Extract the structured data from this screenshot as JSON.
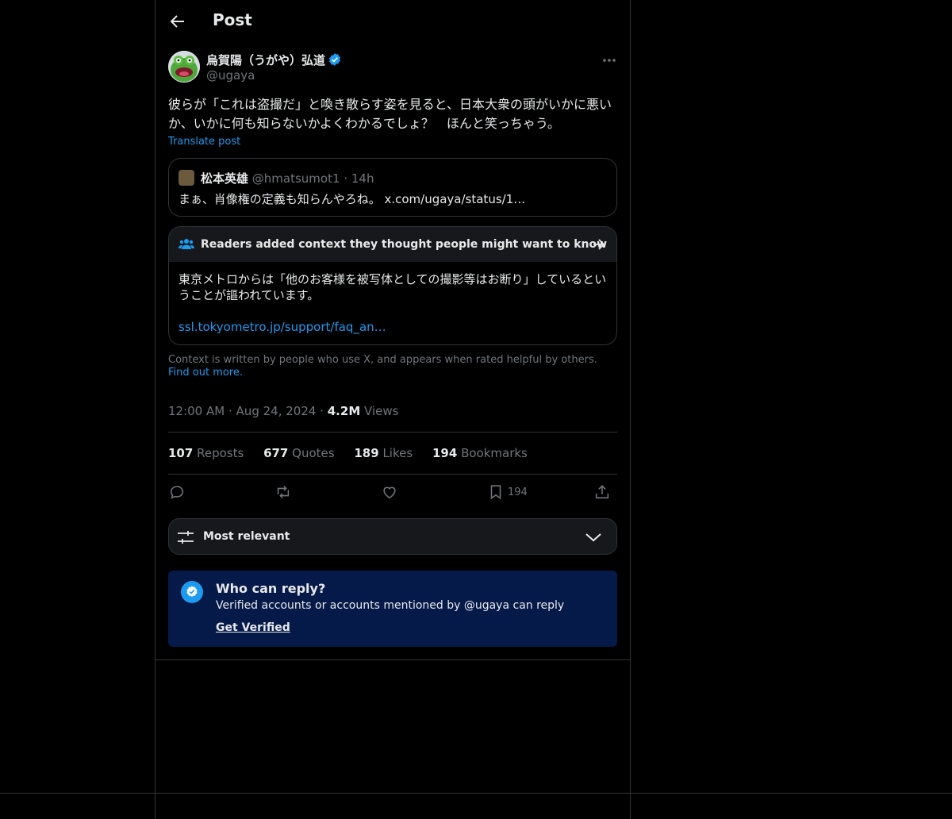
{
  "header": {
    "title": "Post"
  },
  "author": {
    "name": "烏賀陽（うがや）弘道",
    "handle": "@ugaya"
  },
  "post": {
    "text": "彼らが「これは盗撮だ」と喚き散らす姿を見ると、日本大衆の頭がいかに悪いか、いかに何も知らないかよくわかるでしょ？　ほんと笑っちゃう。",
    "translate_label": "Translate post"
  },
  "quote": {
    "name": "松本英雄",
    "handle": "@hmatsumot1",
    "separator": "·",
    "time": "14h",
    "text": "まぁ、肖像権の定義も知らんやろね。 x.com/ugaya/status/1…"
  },
  "community_note": {
    "title": "Readers added context they thought people might want to know",
    "body": "東京メトロからは「他のお客様を被写体としての撮影等はお断り」しているということが謳われています。",
    "link": "ssl.tokyometro.jp/support/faq_an…"
  },
  "context_footer": {
    "text": "Context is written by people who use X, and appears when rated helpful by others.",
    "link": "Find out more."
  },
  "meta": {
    "time": "12:00 AM",
    "date": "Aug 24, 2024",
    "views_count": "4.2M",
    "views_label": "Views",
    "dot": "·"
  },
  "stats": [
    {
      "count": "107",
      "label": "Reposts"
    },
    {
      "count": "677",
      "label": "Quotes"
    },
    {
      "count": "189",
      "label": "Likes"
    },
    {
      "count": "194",
      "label": "Bookmarks"
    }
  ],
  "actions": {
    "bookmark_count": "194"
  },
  "sort": {
    "label": "Most relevant"
  },
  "reply_restriction": {
    "title": "Who can reply?",
    "description": "Verified accounts or accounts mentioned by @ugaya can reply",
    "cta": "Get Verified"
  },
  "icons": {
    "back": "arrow-left-icon",
    "verified": "verified-badge-icon",
    "more": "more-icon",
    "community": "people-icon",
    "note_arrow": "arrow-right-icon",
    "reply": "reply-icon",
    "repost": "repost-icon",
    "like": "heart-icon",
    "bookmark": "bookmark-icon",
    "share": "share-icon",
    "sort": "sliders-icon",
    "chevron": "chevron-down-icon"
  },
  "colors": {
    "accent": "#1d9bf0",
    "background": "#000000",
    "note_header": "#16181c",
    "reply_box": "#061a4a",
    "muted_text": "#71767b"
  }
}
